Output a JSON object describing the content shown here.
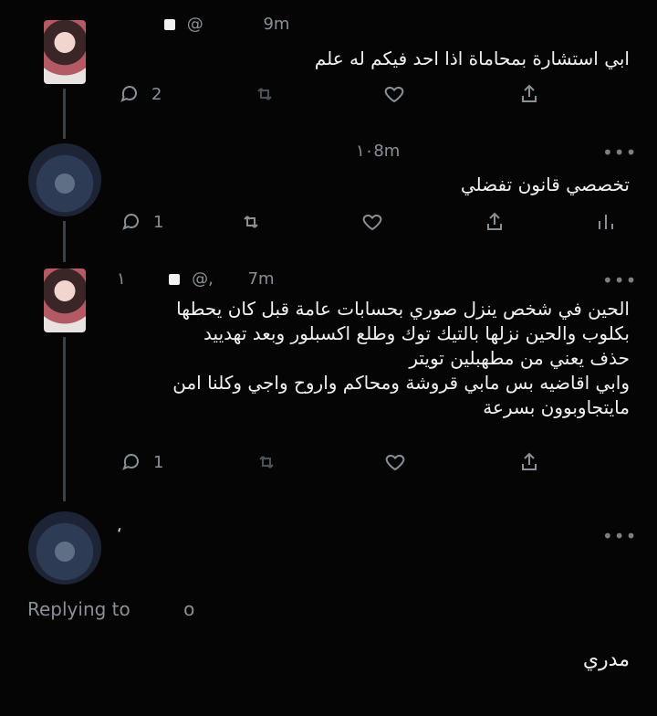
{
  "tweets": [
    {
      "handle": "@",
      "time": "9m",
      "text": "ابي استشارة بمحاماة اذا احد فيكم له علم",
      "reply_count": "2"
    },
    {
      "time": "١٠8m",
      "text": "تخصصي قانون تفضلي",
      "reply_count": "1"
    },
    {
      "name_fragment": "١",
      "handle": "@,",
      "time": "7m",
      "text": "الحين في شخص ينزل صوري بحسابات عامة قبل كان يحطها\nبكلوب والحين نزلها بالتيك توك وطلع اكسبلور وبعد تهدييد\nحذف يعني من مطهبلين تويتر\nوابي اقاضيه بس مابي قروشة ومحاكم واروح واجي وكلنا امن\nمايتجاوبوون بسرعة",
      "reply_count": "1"
    },
    {
      "name_fragment": "‘",
      "reply_label": "Replying to",
      "reply_handle": "o",
      "text": "مدري"
    }
  ]
}
